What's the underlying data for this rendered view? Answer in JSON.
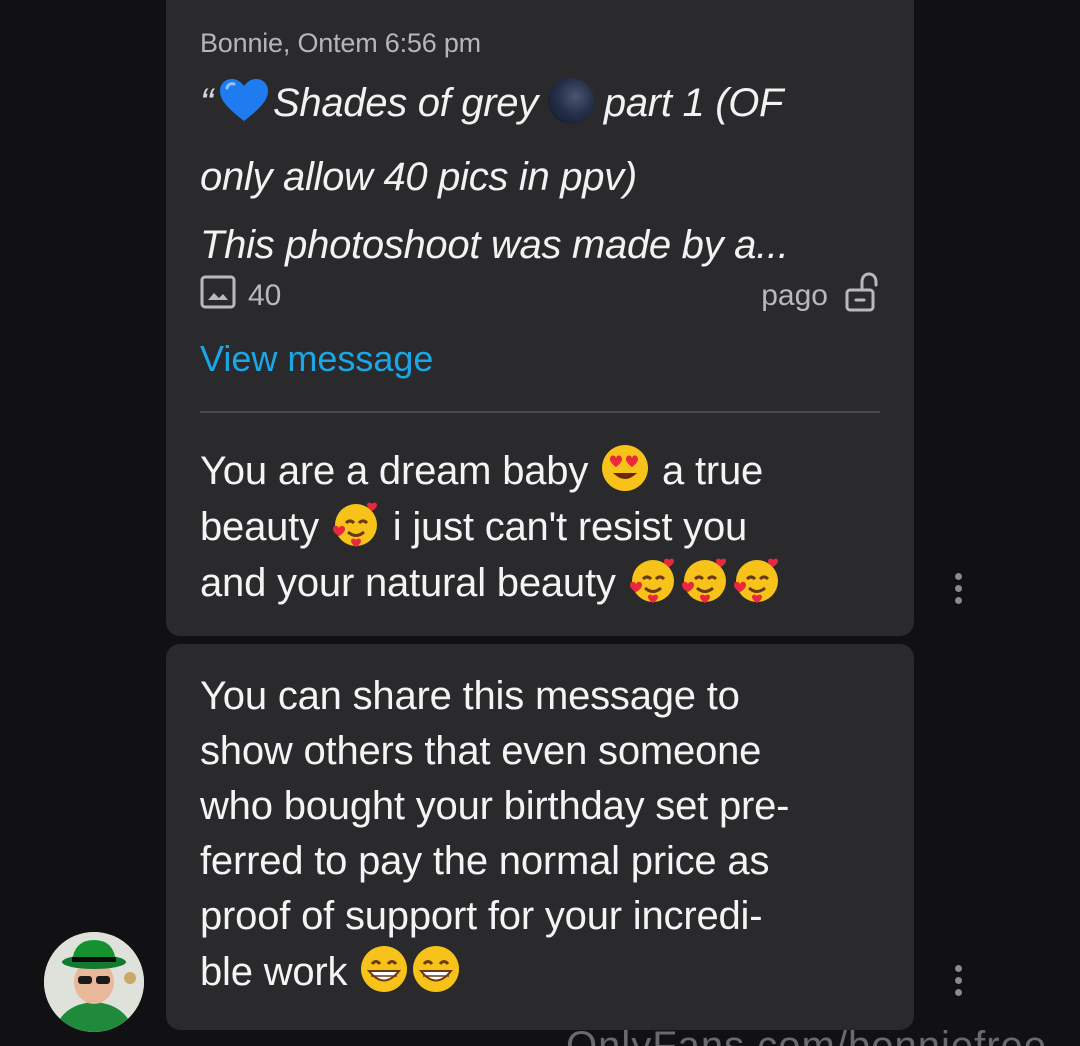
{
  "quoted_message": {
    "sender_time": "Bonnie, Ontem 6:56 pm",
    "open_quote": "“",
    "line1_part1": "Shades of grey",
    "line1_part2": "part 1 (OF",
    "line2": "only allow 40 pics in ppv)",
    "line3": "This photoshoot was made by a...",
    "media_count": "40",
    "paid_label": "pago",
    "view_link": "View message",
    "heart_emoji": "blue-heart-icon",
    "moon_emoji": "new-moon-icon"
  },
  "message_1": {
    "line1_a": "You are a dream baby",
    "line1_b": "a true",
    "line2_a": "beauty",
    "line2_b": "i just can't resist you",
    "line3": "and your natural beauty"
  },
  "message_2": {
    "lines": [
      "You can share this message to",
      "show others that even someone",
      "who bought your birthday set pre-",
      "ferred to pay the normal price as",
      "proof of support for your incredi-",
      "ble work"
    ]
  },
  "watermark": "OnlyFans.com/bonniefree",
  "colors": {
    "background": "#111113",
    "bubble": "#2a2a2c",
    "link": "#1aa7e6",
    "text": "#f4f4f4",
    "muted": "#b9b9bb"
  }
}
